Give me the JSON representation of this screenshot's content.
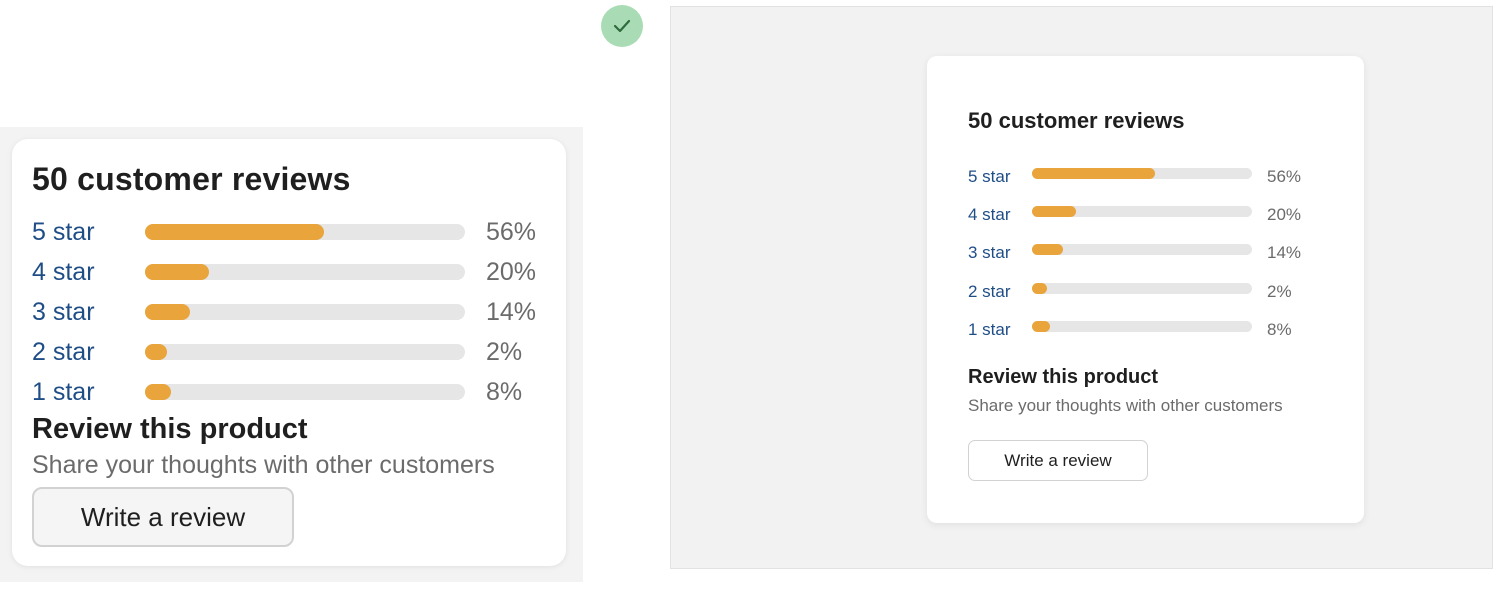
{
  "reviews": {
    "title": "50 customer reviews",
    "ratings": [
      {
        "label": "5 star",
        "percent_text": "56%",
        "fraction": 0.56
      },
      {
        "label": "4 star",
        "percent_text": "20%",
        "fraction": 0.2
      },
      {
        "label": "3 star",
        "percent_text": "14%",
        "fraction": 0.14
      },
      {
        "label": "2 star",
        "percent_text": "2%",
        "fraction": 0.02
      },
      {
        "label": "1 star",
        "percent_text": "8%",
        "fraction": 0.08
      }
    ],
    "review_heading": "Review this product",
    "review_subtext": "Share your thoughts with other customers",
    "button_label": "Write a review"
  },
  "status": {
    "icon": "check-icon",
    "color": "#a9dcb4"
  },
  "colors": {
    "bar_fill": "#e9a43c",
    "bar_track": "#e6e6e6",
    "link": "#1f4e87"
  }
}
